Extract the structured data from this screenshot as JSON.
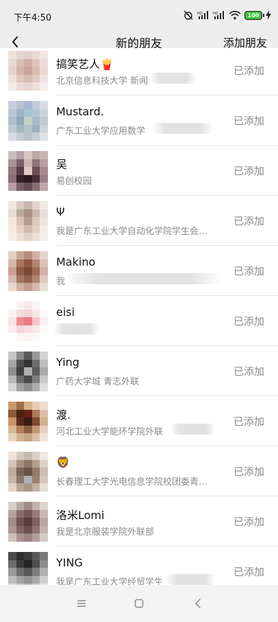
{
  "status_bar": {
    "time": "下午4:50",
    "battery": "100"
  },
  "header": {
    "title": "新的朋友",
    "action": "添加朋友"
  },
  "friends": [
    {
      "name": "搞笑艺人🍟",
      "desc": "北京信息科技大学 新闻",
      "status": "已添加"
    },
    {
      "name": "Mustard.",
      "desc": "广东工业大学应用数学",
      "status": "已添加"
    },
    {
      "name": "吴",
      "desc": "易创校园",
      "status": "已添加"
    },
    {
      "name": "Ψ",
      "desc": "我是广东工业大学自动化学院学生会…",
      "status": "已添加"
    },
    {
      "name": "Makino",
      "desc": "我",
      "status": "已添加"
    },
    {
      "name": "eisi",
      "desc": "",
      "status": "已添加"
    },
    {
      "name": "Ying",
      "desc": "广药大学城 青志外联",
      "status": "已添加"
    },
    {
      "name": "渡.",
      "desc": "河北工业大学能环学院外联",
      "status": "已添加"
    },
    {
      "name": "🦁",
      "desc": "长春理工大学光电信息学院校团委青…",
      "status": "已添加"
    },
    {
      "name": "洛米Lomi",
      "desc": "我是北京服装学院外联部",
      "status": "已添加"
    },
    {
      "name": "YING",
      "desc": "我是广东工业大学经贸学生",
      "status": "已添加"
    }
  ],
  "colors": {
    "background": "#ededed",
    "row_background": "#ffffff",
    "muted_text": "#8a8a8a",
    "battery_green": "#3cc13b"
  }
}
